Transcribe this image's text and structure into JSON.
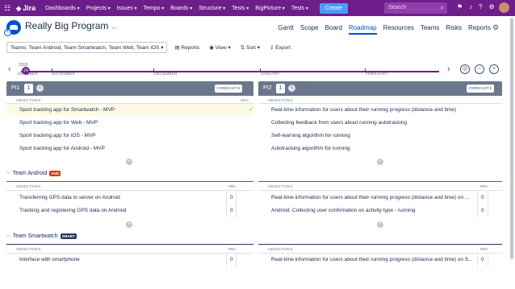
{
  "topnav": {
    "logo": "Jira",
    "menu": [
      "Dashboards",
      "Projects",
      "Issues",
      "Tempo",
      "Boards",
      "Structure",
      "Tests",
      "BigPicture",
      "Tests"
    ],
    "create": "Create",
    "search_placeholder": "Search"
  },
  "header": {
    "title": "Really Big Program",
    "tabs": [
      "Gantt",
      "Scope",
      "Board",
      "Roadmap",
      "Resources",
      "Teams",
      "Risks",
      "Reports"
    ],
    "active_tab": "Roadmap"
  },
  "toolbar": {
    "teams_filter": "Teams: Team Android, Team Smartwatch, Team Web, Team iOS",
    "reports": "Reports",
    "view": "View",
    "sort": "Sort",
    "export": "Export"
  },
  "timeline": {
    "year": "2018",
    "current_marker": "24",
    "months": [
      "OCTOBER",
      "NOVEMBER",
      "DECEMBER",
      "JANUARY",
      "FEBRUARY"
    ]
  },
  "pi1": {
    "name": "PI1",
    "count": "1",
    "forecast": "FORECAST",
    "objectives_label": "OBJECTIVES",
    "percent": "25%",
    "objectives": [
      "Sport tracking app for Smartwatch - MVP",
      "Sport tracking app for Web - MVP",
      "Sport tracking app for iOS - MVP",
      "Sport tracking app for Android - MVP"
    ]
  },
  "pi2": {
    "name": "PI2",
    "count": "1",
    "forecast": "FORECAST",
    "objectives_label": "OBJECTIVES",
    "objectives": [
      "Real-time information for users about their running progress (distance and time)",
      "Collecting feedback from users about running autotracking",
      "Self-learning algorithm for running",
      "Autotracking algorithm for running"
    ]
  },
  "teams": [
    {
      "name": "Team Android",
      "badge": "AND",
      "color": "#de350b",
      "objectives_label": "OBJECTIVES",
      "pbv_label": "PBV",
      "left": [
        {
          "text": "Transferring GPS data to server on Android",
          "pbv": "0"
        },
        {
          "text": "Tracking and registering GPS data on Android",
          "pbv": "0"
        }
      ],
      "right": [
        {
          "text": "Real-time information for users about their running progress (distance and time) on ...",
          "pbv": "0"
        },
        {
          "text": "Android: Collecting user confirmation on activity type - running",
          "pbv": "0"
        }
      ]
    },
    {
      "name": "Team Smartwatch",
      "badge": "SMART",
      "color": "#253858",
      "objectives_label": "OBJECTIVES",
      "pbv_label": "PBV",
      "left": [
        {
          "text": "Interface with smartphone",
          "pbv": "0"
        }
      ],
      "right": [
        {
          "text": "Real-time information for users about their running progress (distance and time) on S...",
          "pbv": "0"
        }
      ]
    }
  ]
}
